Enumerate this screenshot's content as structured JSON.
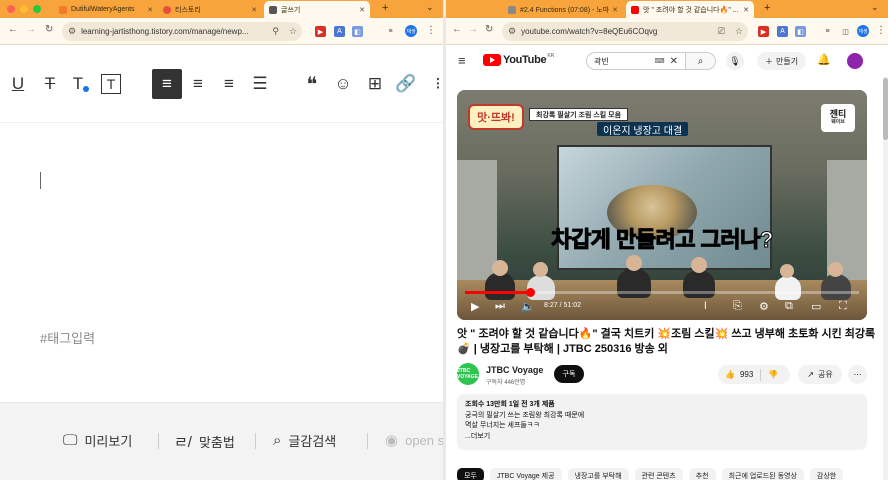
{
  "left_window": {
    "tabs": [
      {
        "label": "DutifulWateryAgents",
        "favicon_color": "#f27a2a"
      },
      {
        "label": "티스토리",
        "favicon_color": "#e94e3c"
      },
      {
        "label": "글쓰기",
        "favicon_color": "#555555"
      }
    ],
    "url": "learning-jartisthong.tistory.com/manage/newp...",
    "profile_label": "재생",
    "toolbar_icons": [
      "underline-icon",
      "strikethrough-icon",
      "text-color-icon",
      "text-background-icon",
      "align-left-icon",
      "align-center-icon",
      "align-right-icon",
      "align-justify-icon",
      "quote-icon",
      "emoticon-icon",
      "table-icon",
      "link-icon",
      "list-icon"
    ],
    "tag_placeholder": "#태그입력",
    "bottom_buttons": {
      "preview": "미리보기",
      "spellcheck": "맞춤법",
      "search": "글감검색",
      "open": "open s"
    }
  },
  "right_window": {
    "tabs": [
      {
        "label": "#2.4 Functions (07:08) - 노마",
        "favicon_color": "#888888"
      },
      {
        "label": "앗 \" 조려야 할 것 같습니다🔥\" ...",
        "favicon_color": "#ff0000"
      }
    ],
    "url": "youtube.com/watch?v=8eQEu6COqvg",
    "youtube": {
      "logo": "YouTube",
      "logo_region": "KR",
      "search_query": "곽빈",
      "create_label": "만들기",
      "video": {
        "show_logo": "맛·뜨봐!",
        "banner": "최강록 필살기 조림 스킬 모음",
        "caption_top": "이온지 냉장고 대결",
        "corner_logo_top": "젠티",
        "corner_logo_bottom": "웨이브",
        "subtitle": "차갑게 만들려고 그러나?",
        "time": "8:27 / 51:02",
        "progress_fraction": 0.165
      },
      "title": "앗 \" 조려야 할 것 같습니다🔥\" 결국 치트키 💥조림 스킬💥 쓰고 냉부해 초토화 시킨 최강록 💣 | 냉장고를 부탁해 | JTBC 250316 방송 외",
      "channel": {
        "avatar_text": "JTBC VOYAGE",
        "name": "JTBC Voyage",
        "subs": "구독자 446만명",
        "subscribe": "구독"
      },
      "actions": {
        "likes": "993",
        "share": "공유"
      },
      "description": {
        "meta": "조회수 13만회  1일 전  3개 제품",
        "line1": "궁극의 필살기 쓰는 조림왕 최강록 때문에",
        "line2": "멱살 무너지는 셰프들ㅋㅋ",
        "more": "...더보기"
      },
      "chips": [
        "모두",
        "JTBC Voyage 제공",
        "냉장고를 부탁해",
        "관련 콘텐츠",
        "추천",
        "최근에 업로드된 동영상",
        "감상한"
      ]
    }
  }
}
